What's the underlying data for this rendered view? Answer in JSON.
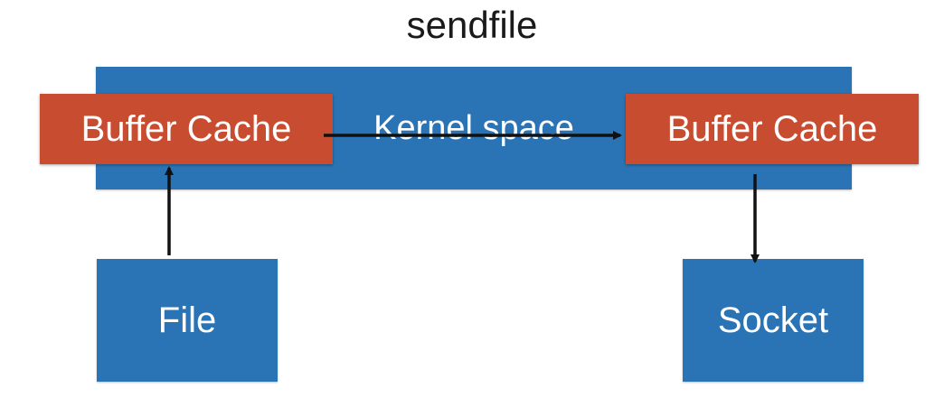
{
  "diagram": {
    "title": "sendfile",
    "kernel_label": "Kernel space",
    "buffer_left_label": "Buffer Cache",
    "buffer_right_label": "Buffer Cache",
    "file_label": "File",
    "socket_label": "Socket",
    "colors": {
      "blue_box": "#2a74b5",
      "red_box": "#c84c30",
      "text_on_box": "#ffffff",
      "arrow": "#111111"
    }
  }
}
